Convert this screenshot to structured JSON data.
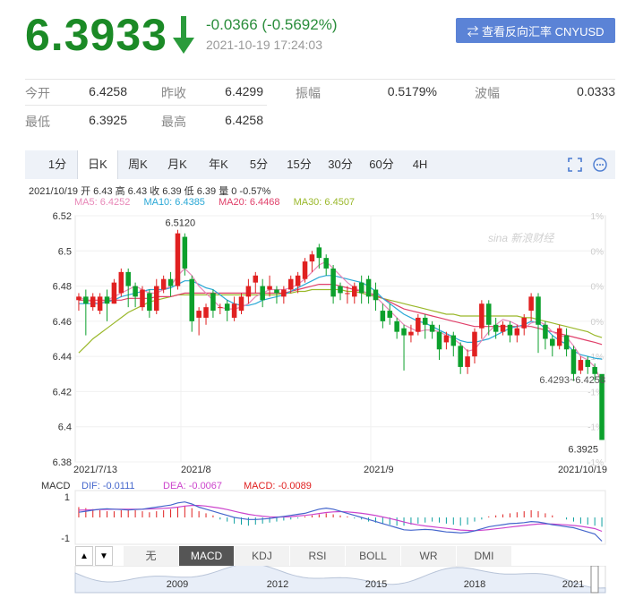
{
  "quote": {
    "price": "6.3933",
    "change": "-0.0366 (-0.5692%)",
    "datetime": "2021-10-19 17:24:03",
    "convert_button": "⇄ 查看反向汇率 CNYUSD"
  },
  "stats": [
    {
      "label": "今开",
      "value": "6.4258"
    },
    {
      "label": "昨收",
      "value": "6.4299"
    },
    {
      "label": "振幅",
      "value": "0.5179%"
    },
    {
      "label": "波幅",
      "value": "0.0333"
    },
    {
      "label": "最低",
      "value": "6.3925"
    },
    {
      "label": "最高",
      "value": "6.4258"
    }
  ],
  "period_tabs": [
    "1分",
    "日K",
    "周K",
    "月K",
    "年K",
    "5分",
    "15分",
    "30分",
    "60分",
    "4H"
  ],
  "active_tab": "日K",
  "info_line": "2021/10/19 开 6.43 高 6.43 收 6.39 低 6.39 量 0 -0.57%",
  "ma": [
    {
      "text": "MA5: 6.4252",
      "color": "#e888b8"
    },
    {
      "text": "MA10: 6.4385",
      "color": "#2aa8d6"
    },
    {
      "text": "MA20: 6.4468",
      "color": "#e0406a"
    },
    {
      "text": "MA30: 6.4507",
      "color": "#9ab82a"
    }
  ],
  "chart": {
    "y_ticks": [
      "6.52",
      "6.5",
      "6.48",
      "6.46",
      "6.44",
      "6.42",
      "6.4",
      "6.38"
    ],
    "pct_ticks": [
      "1%",
      "0%",
      "0%",
      "0%",
      "-1%",
      "-1%",
      "-1%",
      "-1%"
    ],
    "x_labels": [
      "2021/7/13",
      "2021/8",
      "2021/9",
      "2021/10/19"
    ],
    "max_label": "6.5120",
    "min_label": "6.3925",
    "range_label": "6.4293~6.4258",
    "watermark": "sina 新浪财经"
  },
  "chart_data": {
    "type": "candlestick",
    "ylim": [
      6.38,
      6.52
    ],
    "candles": [
      [
        6.472,
        6.474,
        6.466,
        6.476
      ],
      [
        6.474,
        6.47,
        6.452,
        6.478
      ],
      [
        6.468,
        6.474,
        6.466,
        6.476
      ],
      [
        6.466,
        6.474,
        6.464,
        6.476
      ],
      [
        6.474,
        6.47,
        6.46,
        6.478
      ],
      [
        6.47,
        6.482,
        6.47,
        6.484
      ],
      [
        6.476,
        6.488,
        6.474,
        6.49
      ],
      [
        6.488,
        6.48,
        6.468,
        6.49
      ],
      [
        6.48,
        6.474,
        6.468,
        6.482
      ],
      [
        6.468,
        6.478,
        6.466,
        6.48
      ],
      [
        6.476,
        6.466,
        6.462,
        6.478
      ],
      [
        6.466,
        6.48,
        6.464,
        6.484
      ],
      [
        6.478,
        6.484,
        6.476,
        6.486
      ],
      [
        6.484,
        6.48,
        6.474,
        6.488
      ],
      [
        6.48,
        6.51,
        6.478,
        6.512
      ],
      [
        6.508,
        6.49,
        6.486,
        6.51
      ],
      [
        6.484,
        6.46,
        6.454,
        6.486
      ],
      [
        6.462,
        6.466,
        6.452,
        6.468
      ],
      [
        6.462,
        6.468,
        6.458,
        6.47
      ],
      [
        6.476,
        6.466,
        6.462,
        6.478
      ],
      [
        6.468,
        6.468,
        6.464,
        6.47
      ],
      [
        6.47,
        6.466,
        6.46,
        6.472
      ],
      [
        6.462,
        6.47,
        6.46,
        6.474
      ],
      [
        6.466,
        6.474,
        6.464,
        6.476
      ],
      [
        6.474,
        6.48,
        6.47,
        6.484
      ],
      [
        6.482,
        6.486,
        6.476,
        6.488
      ],
      [
        6.48,
        6.472,
        6.468,
        6.484
      ],
      [
        6.478,
        6.48,
        6.474,
        6.486
      ],
      [
        6.478,
        6.476,
        6.47,
        6.48
      ],
      [
        6.474,
        6.478,
        6.47,
        6.48
      ],
      [
        6.478,
        6.484,
        6.476,
        6.486
      ],
      [
        6.48,
        6.486,
        6.476,
        6.488
      ],
      [
        6.484,
        6.494,
        6.482,
        6.496
      ],
      [
        6.494,
        6.498,
        6.488,
        6.5
      ],
      [
        6.502,
        6.496,
        6.49,
        6.504
      ],
      [
        6.496,
        6.49,
        6.486,
        6.498
      ],
      [
        6.49,
        6.474,
        6.47,
        6.492
      ],
      [
        6.48,
        6.476,
        6.472,
        6.482
      ],
      [
        6.476,
        6.476,
        6.47,
        6.48
      ],
      [
        6.474,
        6.48,
        6.47,
        6.482
      ],
      [
        6.482,
        6.476,
        6.47,
        6.486
      ],
      [
        6.484,
        6.474,
        6.47,
        6.486
      ],
      [
        6.478,
        6.472,
        6.466,
        6.482
      ],
      [
        6.466,
        6.46,
        6.456,
        6.47
      ],
      [
        6.466,
        6.462,
        6.458,
        6.47
      ],
      [
        6.46,
        6.454,
        6.45,
        6.462
      ],
      [
        6.456,
        6.452,
        6.432,
        6.458
      ],
      [
        6.452,
        6.454,
        6.448,
        6.458
      ],
      [
        6.454,
        6.462,
        6.452,
        6.464
      ],
      [
        6.462,
        6.458,
        6.45,
        6.464
      ],
      [
        6.458,
        6.454,
        6.45,
        6.46
      ],
      [
        6.454,
        6.444,
        6.438,
        6.458
      ],
      [
        6.448,
        6.452,
        6.444,
        6.454
      ],
      [
        6.452,
        6.446,
        6.44,
        6.454
      ],
      [
        6.446,
        6.434,
        6.43,
        6.448
      ],
      [
        6.434,
        6.44,
        6.43,
        6.444
      ],
      [
        6.44,
        6.454,
        6.436,
        6.456
      ],
      [
        6.456,
        6.47,
        6.45,
        6.472
      ],
      [
        6.47,
        6.458,
        6.452,
        6.472
      ],
      [
        6.458,
        6.454,
        6.45,
        6.462
      ],
      [
        6.454,
        6.458,
        6.452,
        6.46
      ],
      [
        6.458,
        6.452,
        6.448,
        6.46
      ],
      [
        6.452,
        6.456,
        6.448,
        6.458
      ],
      [
        6.456,
        6.462,
        6.452,
        6.464
      ],
      [
        6.466,
        6.474,
        6.46,
        6.476
      ],
      [
        6.474,
        6.458,
        6.442,
        6.476
      ],
      [
        6.458,
        6.45,
        6.444,
        6.46
      ],
      [
        6.45,
        6.446,
        6.44,
        6.452
      ],
      [
        6.446,
        6.456,
        6.444,
        6.458
      ],
      [
        6.452,
        6.444,
        6.44,
        6.456
      ],
      [
        6.444,
        6.43,
        6.426,
        6.446
      ],
      [
        6.432,
        6.438,
        6.43,
        6.44
      ],
      [
        6.438,
        6.434,
        6.43,
        6.44
      ],
      [
        6.434,
        6.43,
        6.426,
        6.436
      ],
      [
        6.43,
        6.3925,
        6.3925,
        6.4258
      ]
    ],
    "ma5": [
      6.474,
      6.472,
      6.471,
      6.47,
      6.472,
      6.474,
      6.476,
      6.478,
      6.48,
      6.478,
      6.476,
      6.476,
      6.478,
      6.48,
      6.486,
      6.49,
      6.486,
      6.48,
      6.476,
      6.472,
      6.468,
      6.467,
      6.467,
      6.468,
      6.47,
      6.474,
      6.476,
      6.478,
      6.478,
      6.478,
      6.479,
      6.481,
      6.484,
      6.488,
      6.492,
      6.494,
      6.49,
      6.486,
      6.482,
      6.479,
      6.477,
      6.476,
      6.474,
      6.47,
      6.466,
      6.462,
      6.458,
      6.456,
      6.454,
      6.455,
      6.455,
      6.454,
      6.452,
      6.45,
      6.447,
      6.443,
      6.444,
      6.449,
      6.454,
      6.458,
      6.461,
      6.46,
      6.458,
      6.456,
      6.459,
      6.46,
      6.458,
      6.454,
      6.452,
      6.451,
      6.446,
      6.44,
      6.438,
      6.434,
      6.425
    ],
    "ma10": [
      6.47,
      6.47,
      6.47,
      6.47,
      6.471,
      6.472,
      6.474,
      6.475,
      6.476,
      6.477,
      6.478,
      6.478,
      6.478,
      6.479,
      6.481,
      6.483,
      6.483,
      6.481,
      6.479,
      6.478,
      6.475,
      6.472,
      6.47,
      6.469,
      6.469,
      6.47,
      6.472,
      6.473,
      6.474,
      6.475,
      6.477,
      6.479,
      6.481,
      6.483,
      6.485,
      6.486,
      6.486,
      6.485,
      6.484,
      6.483,
      6.482,
      6.48,
      6.477,
      6.473,
      6.47,
      6.467,
      6.464,
      6.462,
      6.46,
      6.459,
      6.457,
      6.455,
      6.453,
      6.451,
      6.449,
      6.448,
      6.448,
      6.449,
      6.45,
      6.452,
      6.454,
      6.456,
      6.457,
      6.458,
      6.46,
      6.459,
      6.456,
      6.452,
      6.449,
      6.447,
      6.443,
      6.441,
      6.44,
      6.439,
      6.4385
    ],
    "ma20": [
      6.472,
      6.472,
      6.472,
      6.472,
      6.472,
      6.472,
      6.472,
      6.473,
      6.473,
      6.473,
      6.473,
      6.474,
      6.474,
      6.474,
      6.475,
      6.476,
      6.476,
      6.476,
      6.476,
      6.476,
      6.476,
      6.476,
      6.476,
      6.476,
      6.476,
      6.476,
      6.476,
      6.476,
      6.476,
      6.476,
      6.477,
      6.478,
      6.479,
      6.48,
      6.481,
      6.481,
      6.481,
      6.48,
      6.479,
      6.478,
      6.477,
      6.476,
      6.475,
      6.473,
      6.471,
      6.469,
      6.467,
      6.466,
      6.465,
      6.464,
      6.463,
      6.462,
      6.461,
      6.46,
      6.459,
      6.458,
      6.457,
      6.457,
      6.457,
      6.457,
      6.457,
      6.457,
      6.457,
      6.457,
      6.457,
      6.456,
      6.455,
      6.454,
      6.453,
      6.452,
      6.451,
      6.45,
      6.449,
      6.448,
      6.4468
    ],
    "ma30": [
      6.442,
      6.446,
      6.45,
      6.453,
      6.456,
      6.459,
      6.462,
      6.465,
      6.467,
      6.469,
      6.471,
      6.472,
      6.473,
      6.474,
      6.475,
      6.475,
      6.475,
      6.475,
      6.475,
      6.475,
      6.475,
      6.475,
      6.475,
      6.475,
      6.475,
      6.475,
      6.475,
      6.475,
      6.475,
      6.476,
      6.476,
      6.477,
      6.477,
      6.478,
      6.478,
      6.478,
      6.478,
      6.478,
      6.477,
      6.477,
      6.476,
      6.475,
      6.474,
      6.473,
      6.472,
      6.471,
      6.47,
      6.469,
      6.468,
      6.467,
      6.466,
      6.465,
      6.464,
      6.464,
      6.463,
      6.463,
      6.463,
      6.463,
      6.463,
      6.463,
      6.463,
      6.463,
      6.463,
      6.462,
      6.462,
      6.461,
      6.46,
      6.459,
      6.458,
      6.457,
      6.456,
      6.455,
      6.454,
      6.452,
      6.4507
    ]
  },
  "macd": {
    "label": "MACD",
    "dif": "DIF: -0.0111",
    "dea": "DEA: -0.0067",
    "macd": "MACD: -0.0089",
    "y_ticks": [
      "1",
      "-1"
    ],
    "bars": [
      0.5,
      0.45,
      0.4,
      0.35,
      0.3,
      0.3,
      0.35,
      0.4,
      0.35,
      0.3,
      0.25,
      0.3,
      0.35,
      0.4,
      0.5,
      0.55,
      0.45,
      0.3,
      0.2,
      0.1,
      -0.1,
      -0.2,
      -0.3,
      -0.35,
      -0.4,
      -0.35,
      -0.3,
      -0.25,
      -0.2,
      -0.15,
      -0.1,
      -0.05,
      0.05,
      0.1,
      0.15,
      0.2,
      0.15,
      0.1,
      0.05,
      -0.05,
      -0.1,
      -0.2,
      -0.25,
      -0.3,
      -0.35,
      -0.4,
      -0.4,
      -0.35,
      -0.3,
      -0.25,
      -0.2,
      -0.25,
      -0.3,
      -0.35,
      -0.4,
      -0.35,
      -0.2,
      -0.1,
      0.05,
      0.1,
      0.15,
      0.2,
      0.25,
      0.3,
      0.35,
      0.3,
      0.2,
      0.1,
      0.0,
      -0.1,
      -0.2,
      -0.3,
      -0.35,
      -0.4,
      -0.45
    ],
    "dif_line": [
      0.25,
      0.3,
      0.35,
      0.4,
      0.42,
      0.4,
      0.38,
      0.36,
      0.38,
      0.4,
      0.45,
      0.5,
      0.55,
      0.6,
      0.7,
      0.75,
      0.65,
      0.5,
      0.4,
      0.3,
      0.2,
      0.1,
      0.0,
      -0.05,
      -0.1,
      -0.1,
      -0.08,
      -0.05,
      0.0,
      0.05,
      0.1,
      0.15,
      0.2,
      0.3,
      0.4,
      0.45,
      0.4,
      0.3,
      0.2,
      0.1,
      0.0,
      -0.1,
      -0.2,
      -0.3,
      -0.4,
      -0.5,
      -0.6,
      -0.62,
      -0.6,
      -0.58,
      -0.6,
      -0.65,
      -0.7,
      -0.72,
      -0.75,
      -0.72,
      -0.65,
      -0.55,
      -0.45,
      -0.4,
      -0.35,
      -0.3,
      -0.28,
      -0.25,
      -0.2,
      -0.22,
      -0.28,
      -0.35,
      -0.4,
      -0.45,
      -0.5,
      -0.6,
      -0.7,
      -0.8,
      -1.15
    ],
    "dea_line": [
      0.35,
      0.36,
      0.37,
      0.38,
      0.39,
      0.4,
      0.4,
      0.4,
      0.4,
      0.4,
      0.41,
      0.42,
      0.44,
      0.46,
      0.5,
      0.55,
      0.58,
      0.58,
      0.55,
      0.5,
      0.45,
      0.38,
      0.3,
      0.22,
      0.15,
      0.1,
      0.06,
      0.03,
      0.02,
      0.02,
      0.04,
      0.07,
      0.1,
      0.14,
      0.19,
      0.24,
      0.27,
      0.28,
      0.27,
      0.24,
      0.2,
      0.15,
      0.09,
      0.02,
      -0.05,
      -0.13,
      -0.22,
      -0.3,
      -0.36,
      -0.41,
      -0.45,
      -0.49,
      -0.53,
      -0.57,
      -0.61,
      -0.63,
      -0.64,
      -0.62,
      -0.59,
      -0.55,
      -0.51,
      -0.47,
      -0.43,
      -0.39,
      -0.35,
      -0.32,
      -0.31,
      -0.32,
      -0.34,
      -0.36,
      -0.39,
      -0.43,
      -0.48,
      -0.54,
      -0.67
    ]
  },
  "indicator_tabs": [
    "无",
    "MACD",
    "KDJ",
    "RSI",
    "BOLL",
    "WR",
    "DMI"
  ],
  "active_indicator": "MACD",
  "timeline_years": [
    "2009",
    "2012",
    "2015",
    "2018",
    "2021"
  ],
  "colors": {
    "up": "#e02020",
    "down": "#0ca02c",
    "price": "#1b8a26",
    "accent": "#5b83d6"
  }
}
